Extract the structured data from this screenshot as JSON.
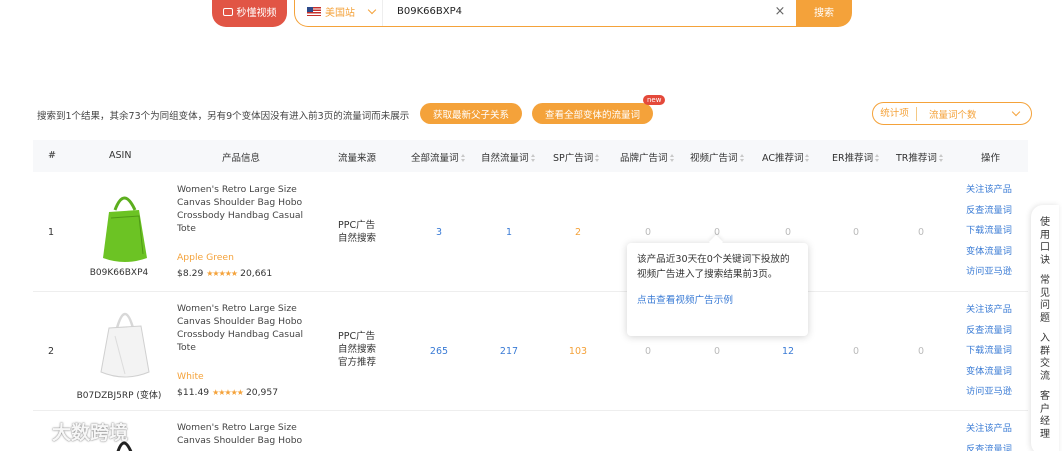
{
  "header": {
    "video_btn": "秒懂视频",
    "market": "美国站",
    "search_value": "B09K66BXP4",
    "clear_symbol": "×",
    "search_btn": "搜索"
  },
  "info": {
    "text": "搜索到1个结果，其余73个为同组变体，另有9个变体因没有进入前3页的流量词而未展示",
    "btn_parent": "获取最新父子关系",
    "btn_all_variants": "查看全部变体的流量词",
    "new_badge": "new",
    "stat_label": "统计项",
    "stat_value": "流量词个数"
  },
  "table": {
    "headers": {
      "idx": "#",
      "asin": "ASIN",
      "product": "产品信息",
      "source": "流量来源",
      "all": "全部流量词",
      "natural": "自然流量词",
      "sp": "SP广告词",
      "brand": "品牌广告词",
      "video": "视频广告词",
      "ac": "AC推荐词",
      "er": "ER推荐词",
      "tr": "TR推荐词",
      "ops": "操作"
    },
    "rows": [
      {
        "idx": "1",
        "asin": "B09K66BXP4",
        "title": "Women's Retro Large Size Canvas Shoulder Bag Hobo Crossbody Handbag Casual Tote",
        "color": "Apple Green",
        "price": "$8.29",
        "stars": "★★★★★",
        "reviews": "20,661",
        "source": "PPC广告\n自然搜索",
        "all": "3",
        "natural": "1",
        "sp": "2",
        "brand": "0",
        "video": "0",
        "ac": "0",
        "er": "0",
        "tr": "0"
      },
      {
        "idx": "2",
        "asin": "B07DZBJ5RP (变体)",
        "title": "Women's Retro Large Size Canvas Shoulder Bag Hobo Crossbody Handbag Casual Tote",
        "color": "White",
        "price": "$11.49",
        "stars": "★★★★★",
        "reviews": "20,957",
        "source": "PPC广告\n自然搜索\n官方推荐",
        "all": "265",
        "natural": "217",
        "sp": "103",
        "brand": "0",
        "video": "0",
        "ac": "12",
        "er": "0",
        "tr": "0"
      },
      {
        "title": "Women's Retro Large Size Canvas Shoulder Bag Hobo"
      }
    ],
    "ops": [
      "关注该产品",
      "反查流量词",
      "下载流量词",
      "变体流量词",
      "访问亚马逊"
    ],
    "ops_partial": [
      "关注该产品",
      "反查流量词"
    ]
  },
  "tooltip": {
    "text": "该产品近30天在0个关键词下投放的视频广告进入了搜索结果前3页。",
    "link": "点击查看视频广告示例"
  },
  "side": [
    "使用口诀",
    "常见问题",
    "入群交流",
    "客户经理"
  ],
  "watermark": "大数跨境",
  "colors": {
    "accent": "#f4a23a",
    "red": "#e15545",
    "link": "#3a7bd5"
  }
}
